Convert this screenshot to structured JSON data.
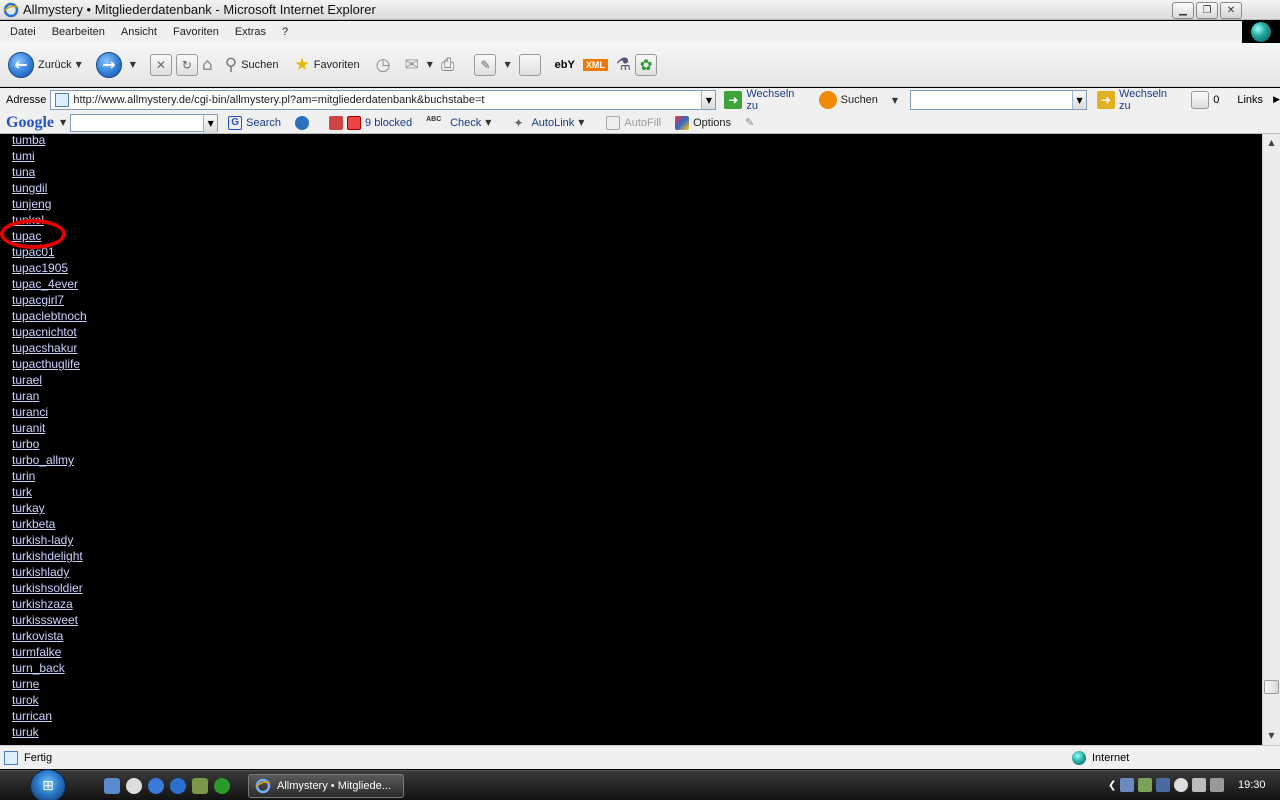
{
  "window": {
    "title": "Allmystery • Mitgliederdatenbank - Microsoft Internet Explorer"
  },
  "menu": [
    "Datei",
    "Bearbeiten",
    "Ansicht",
    "Favoriten",
    "Extras",
    "?"
  ],
  "toolbar": {
    "back_label": "Zurück",
    "search_label": "Suchen",
    "favorites_label": "Favoriten",
    "ebay_label": "ebY",
    "xml_label": "XML"
  },
  "address": {
    "label": "Adresse",
    "url": "http://www.allmystery.de/cgi-bin/allmystery.pl?am=mitgliederdatenbank&buchstabe=t",
    "go_label": "Wechseln zu",
    "search_label": "Suchen",
    "go2_label": "Wechseln zu",
    "counter": "0",
    "links_label": "Links"
  },
  "googlebar": {
    "logo": "Google",
    "search_label": "Search",
    "blocked_label": "9 blocked",
    "check_label": "Check",
    "autolink_label": "AutoLink",
    "autofill_label": "AutoFill",
    "options_label": "Options"
  },
  "members": [
    "tumba",
    "tumi",
    "tuna",
    "tungdil",
    "tunjeng",
    "tunkel",
    "tupac",
    "tupac01",
    "tupac1905",
    "tupac_4ever",
    "tupacgirl7",
    "tupaclebtnoch",
    "tupacnichtot",
    "tupacshakur",
    "tupacthuglife",
    "turael",
    "turan",
    "turanci",
    "turanit",
    "turbo",
    "turbo_allmy",
    "turin",
    "turk",
    "turkay",
    "turkbeta",
    "turkish-lady",
    "turkishdelight",
    "turkishlady",
    "turkishsoldier",
    "turkishzaza",
    "turkisssweet",
    "turkovista",
    "turmfalke",
    "turn_back",
    "turne",
    "turok",
    "turrican",
    "turuk"
  ],
  "highlighted_member": "tupac",
  "status": {
    "text": "Fertig",
    "zone": "Internet"
  },
  "taskbar": {
    "task_label": "Allmystery • Mitgliede...",
    "clock": "19:30"
  },
  "colors": {
    "link": "#c9d2ff",
    "background": "#000000",
    "highlight_ring": "#e00000"
  }
}
